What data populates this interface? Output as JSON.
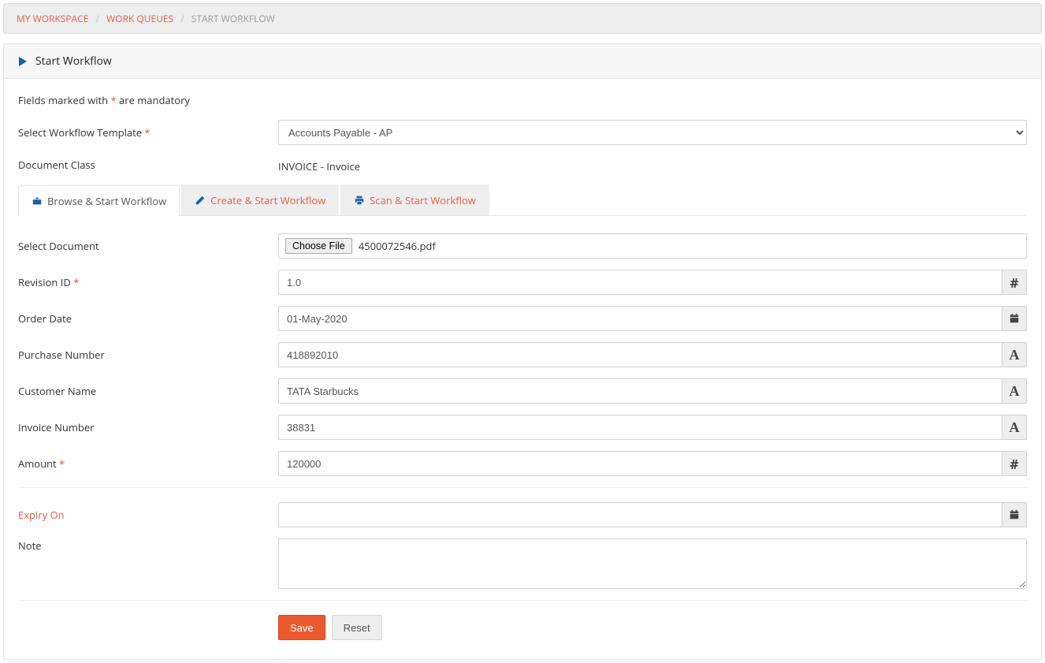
{
  "breadcrumb": {
    "items": [
      "MY WORKSPACE",
      "WORK QUEUES"
    ],
    "current": "START WORKFLOW"
  },
  "panel": {
    "title": "Start Workflow"
  },
  "mandatory_note_prefix": "Fields marked with ",
  "mandatory_note_suffix": " are mandatory",
  "mandatory_star": "*",
  "labels": {
    "workflow_template": "Select Workflow Template",
    "document_class": "Document Class",
    "select_document": "Select Document",
    "revision_id": "Revision ID",
    "order_date": "Order Date",
    "purchase_number": "Purchase Number",
    "customer_name": "Customer Name",
    "invoice_number": "Invoice Number",
    "amount": "Amount",
    "expiry_on": "Expiry On",
    "note": "Note"
  },
  "values": {
    "workflow_template": "Accounts Payable - AP",
    "document_class": "INVOICE - Invoice",
    "file_button": "Choose File",
    "file_name": "4500072546.pdf",
    "revision_id": "1.0",
    "order_date": "01-May-2020",
    "purchase_number": "418892010",
    "customer_name": "TATA Starbucks",
    "invoice_number": "38831",
    "amount": "120000",
    "expiry_on": "",
    "note": ""
  },
  "tabs": {
    "browse": "Browse & Start Workflow",
    "create": "Create & Start Workflow",
    "scan": "Scan & Start Workflow"
  },
  "buttons": {
    "save": "Save",
    "reset": "Reset"
  },
  "icons": {
    "hash": "#",
    "letter_a": "A"
  }
}
